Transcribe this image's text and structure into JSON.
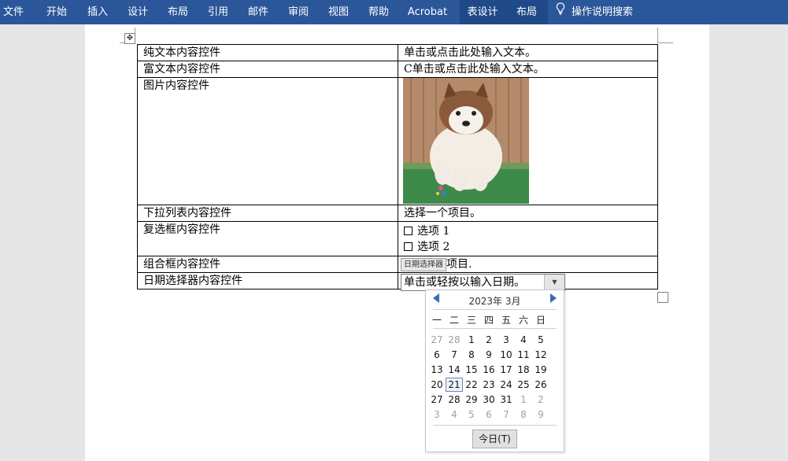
{
  "ribbon": {
    "tabs": [
      "文件",
      "开始",
      "插入",
      "设计",
      "布局",
      "引用",
      "邮件",
      "审阅",
      "视图",
      "帮助",
      "Acrobat",
      "表设计",
      "布局"
    ],
    "tell_me": "操作说明搜索",
    "bg_color": "#2b579a"
  },
  "table": {
    "rows": [
      {
        "label": "纯文本内容控件",
        "value": "单击或点击此处输入文本。"
      },
      {
        "label": "富文本内容控件",
        "value": "C单击或点击此处输入文本。"
      },
      {
        "label": "图片内容控件"
      },
      {
        "label": "下拉列表内容控件",
        "value": "选择一个项目。"
      },
      {
        "label": "复选框内容控件",
        "checkbox_items": [
          "选项 1",
          "选项 2"
        ]
      },
      {
        "label": "组合框内容控件",
        "tag": "日期选择器",
        "value_suffix": "项目."
      },
      {
        "label": "日期选择器内容控件"
      }
    ],
    "date_field_text": "单击或轻按以输入日期。"
  },
  "calendar": {
    "month_label": "2023年 3月",
    "weekdays": [
      "一",
      "二",
      "三",
      "四",
      "五",
      "六",
      "日"
    ],
    "weeks": [
      [
        "27",
        "28",
        "1",
        "2",
        "3",
        "4",
        "5"
      ],
      [
        "6",
        "7",
        "8",
        "9",
        "10",
        "11",
        "12"
      ],
      [
        "13",
        "14",
        "15",
        "16",
        "17",
        "18",
        "19"
      ],
      [
        "20",
        "21",
        "22",
        "23",
        "24",
        "25",
        "26"
      ],
      [
        "27",
        "28",
        "29",
        "30",
        "31",
        "1",
        "2"
      ],
      [
        "3",
        "4",
        "5",
        "6",
        "7",
        "8",
        "9"
      ]
    ],
    "selected": "21",
    "today_label": "今日(T)"
  }
}
